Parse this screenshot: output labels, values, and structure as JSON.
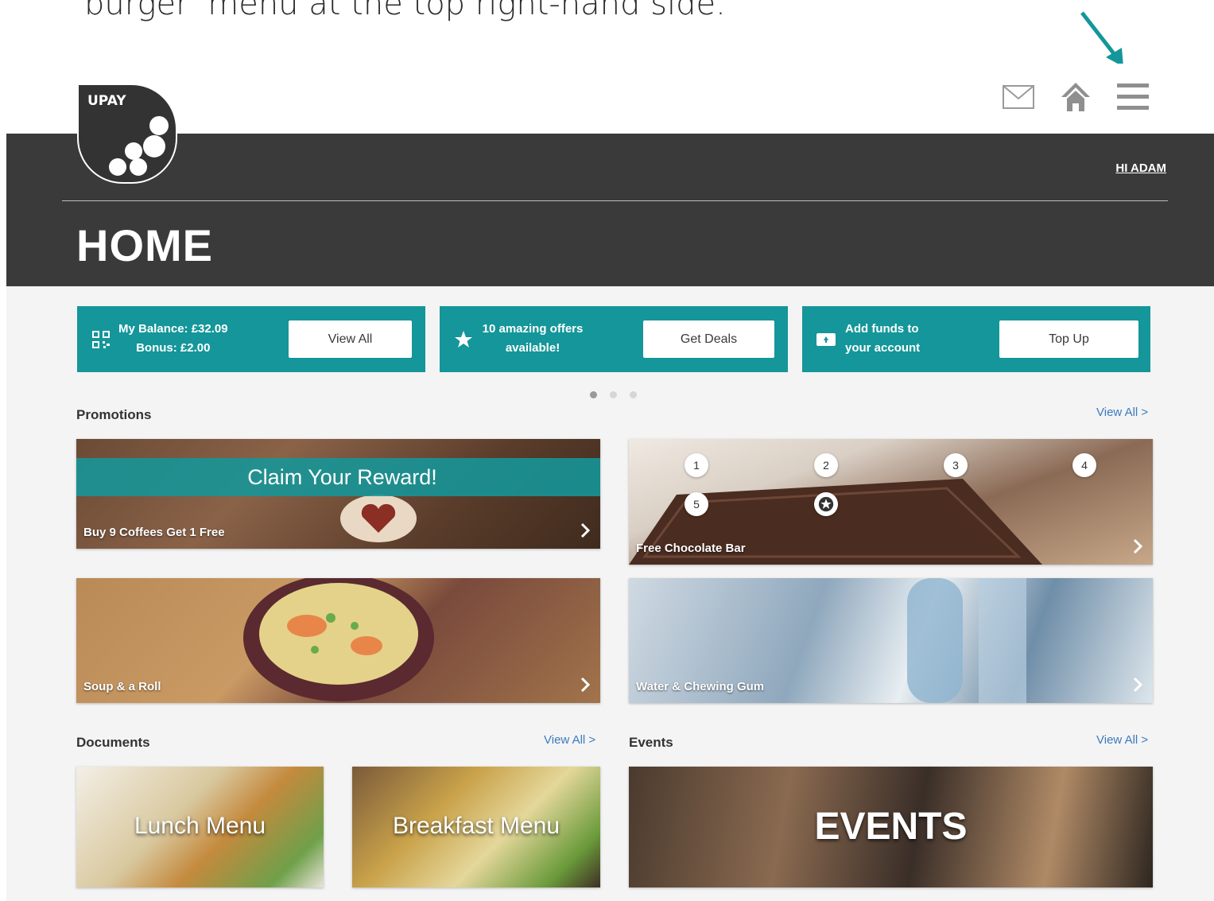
{
  "instruction": {
    "text": "'burger' menu at the top right-hand side."
  },
  "header": {
    "logo_text": "UPAY",
    "icons": [
      "mail-icon",
      "home-icon",
      "hamburger-menu-icon"
    ],
    "greeting": "HI ADAM",
    "page_title": "HOME"
  },
  "tiles": [
    {
      "icon": "qr-code-icon",
      "line1": "My Balance: £32.09",
      "line2": "Bonus: £2.00",
      "button": "View All"
    },
    {
      "icon": "star-icon",
      "line1": "10 amazing offers",
      "line2": "available!",
      "button": "Get Deals"
    },
    {
      "icon": "wallet-icon",
      "line1": "Add funds to",
      "line2": "your account",
      "button": "Top Up"
    }
  ],
  "carousel": {
    "total": 3,
    "active": 1
  },
  "promotions": {
    "title": "Promotions",
    "view_all": "View All >",
    "cards": [
      {
        "label": "Buy 9 Coffees Get 1 Free",
        "banner": "Claim Your Reward!"
      },
      {
        "label": "Free Chocolate Bar",
        "steps": [
          "1",
          "2",
          "3",
          "4",
          "5"
        ]
      },
      {
        "label": "Soup & a Roll"
      },
      {
        "label": "Water & Chewing Gum"
      }
    ]
  },
  "documents": {
    "title": "Documents",
    "view_all": "View All >",
    "cards": [
      {
        "title": "Lunch Menu"
      },
      {
        "title": "Breakfast Menu"
      }
    ]
  },
  "events": {
    "title": "Events",
    "view_all": "View All >",
    "cards": [
      {
        "title": "EVENTS"
      }
    ]
  },
  "colors": {
    "teal": "#14969a",
    "dark": "#3a3a3a",
    "link": "#3a7bbf"
  }
}
